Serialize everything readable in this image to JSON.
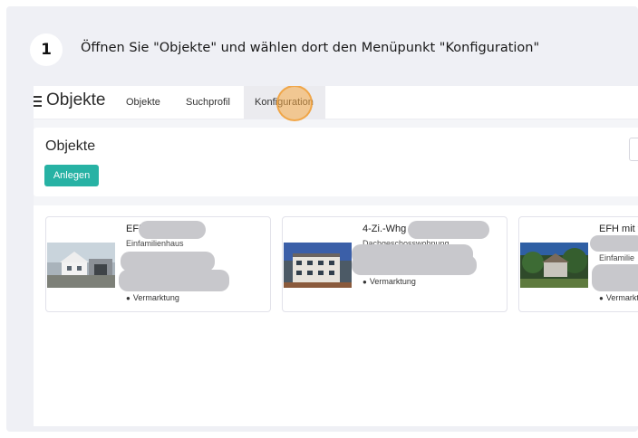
{
  "step": {
    "number": "1",
    "instruction": "Öffnen Sie \"Objekte\" und wählen dort den Menüpunkt \"Konfiguration\""
  },
  "app": {
    "title": "Objekte",
    "nav": [
      {
        "label": "Objekte"
      },
      {
        "label": "Suchprofil"
      },
      {
        "label": "Konfiguration"
      }
    ],
    "active_tab": "Konfiguration"
  },
  "panel": {
    "title": "Objekte",
    "create_button": "Anlegen"
  },
  "cards": [
    {
      "title": "EFH",
      "subtype": "Einfamilienhaus",
      "fragment": "0",
      "status": "Vermarktung",
      "photo": "house-photo"
    },
    {
      "title": "4-Zi.-Whg",
      "subtype": "Dachgeschosswohnung",
      "fragment": "",
      "status": "Vermarktung",
      "photo": "apartment-building-photo"
    },
    {
      "title": "EFH mit v",
      "subtype": "Einfamilie",
      "fragment": "",
      "status": "Vermarkt",
      "photo": "house-garden-photo"
    }
  ],
  "colors": {
    "accent": "#27b2a4",
    "frame_bg": "#eff0f5",
    "click_marker": "#f6aa46"
  }
}
